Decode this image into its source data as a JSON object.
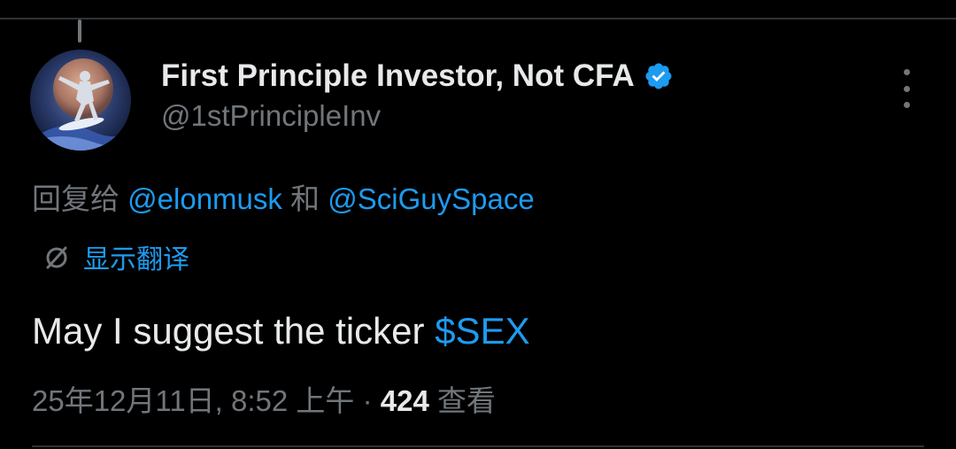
{
  "author": {
    "display_name": "First Principle Investor, Not CFA",
    "handle": "@1stPrincipleInv",
    "verified": true
  },
  "reply": {
    "prefix": "回复给 ",
    "mention_1": "@elonmusk",
    "conjunction": " 和 ",
    "mention_2": "@SciGuySpace"
  },
  "translate": {
    "label": "显示翻译"
  },
  "tweet": {
    "text": "May I suggest the ticker ",
    "cashtag": "$SEX"
  },
  "meta": {
    "timestamp": "25年12月11日, 8:52 上午",
    "separator": " · ",
    "views_count": "424",
    "views_label": " 查看"
  },
  "icons": {
    "avatar": "silver-surfer-avatar",
    "verified": "verified-badge-icon",
    "more": "more-options-icon",
    "translate": "translate-icon"
  },
  "colors": {
    "background": "#000000",
    "primary_text": "#e7e9ea",
    "secondary_text": "#71767b",
    "accent": "#1d9bf0",
    "divider": "#2f3336"
  }
}
